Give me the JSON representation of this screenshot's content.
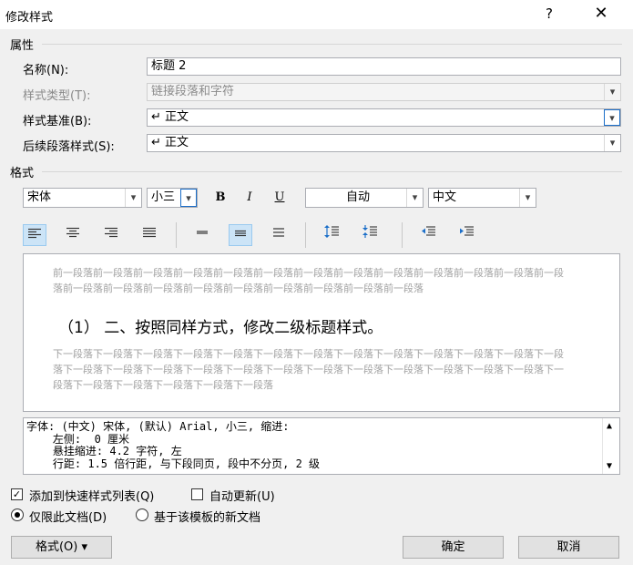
{
  "window": {
    "title": "修改样式",
    "help_label": "?",
    "close_label": "✕"
  },
  "properties": {
    "section_label": "属性",
    "name_label": "名称(N):",
    "name_value": "标题 2",
    "style_type_label": "样式类型(T):",
    "style_type_value": "链接段落和字符",
    "based_on_label": "样式基准(B):",
    "based_on_value": "↵ 正文",
    "next_style_label": "后续段落样式(S):",
    "next_style_value": "↵ 正文"
  },
  "format": {
    "section_label": "格式",
    "font_value": "宋体",
    "size_value": "小三",
    "bold_label": "B",
    "italic_label": "I",
    "underline_label": "U",
    "color_value": "自动",
    "script_value": "中文"
  },
  "preview": {
    "prev_paragraph": "前一段落前一段落前一段落前一段落前一段落前一段落前一段落前一段落前一段落前一段落前一段落前一段落前一段落前一段落前一段落前一段落前一段落前一段落前一段落前一段落前一段落前一段落",
    "sample_text": "（1） 二、按照同样方式，修改二级标题样式。",
    "next_paragraph": "下一段落下一段落下一段落下一段落下一段落下一段落下一段落下一段落下一段落下一段落下一段落下一段落下一段落下一段落下一段落下一段落下一段落下一段落下一段落下一段落下一段落下一段落下一段落下一段落下一段落下一段落下一段落下一段落下一段落下一段落下一段落"
  },
  "description": {
    "line1": "字体: (中文) 宋体, (默认) Arial, 小三, 缩进:",
    "line2": "    左侧:  0 厘米",
    "line3": "    悬挂缩进: 4.2 字符, 左",
    "line4": "    行距: 1.5 倍行距, 与下段同页, 段中不分页, 2 级"
  },
  "options": {
    "add_to_gallery_label": "添加到快速样式列表(Q)",
    "add_to_gallery_checked": true,
    "auto_update_label": "自动更新(U)",
    "auto_update_checked": false,
    "only_this_doc_label": "仅限此文档(D)",
    "new_docs_label": "基于该模板的新文档"
  },
  "buttons": {
    "format_label": "格式(O) ▾",
    "ok_label": "确定",
    "cancel_label": "取消"
  },
  "colors": {
    "accent": "#1c6fc9",
    "toolbar_active": "#cce4f7"
  }
}
